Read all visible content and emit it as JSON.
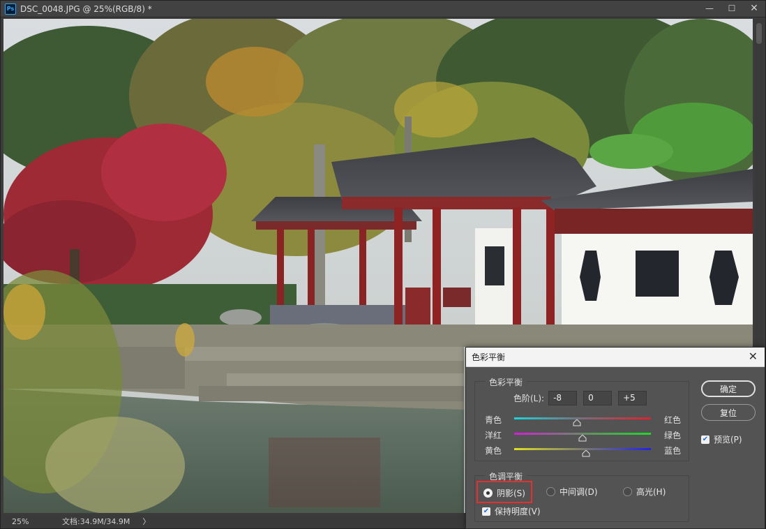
{
  "document": {
    "title": "DSC_0048.JPG @ 25%(RGB/8) *",
    "app_icon": "Ps",
    "zoom": "25%",
    "doc_info": "文档:34.9M/34.9M",
    "status_arrow": "〉",
    "controls": {
      "minimize": "—",
      "maximize": "☐",
      "close": "✕"
    }
  },
  "dialog": {
    "title": "色彩平衡",
    "close": "✕",
    "color_balance": {
      "group_label": "色彩平衡",
      "levels_label": "色阶(L):",
      "levels": [
        "-8",
        "0",
        "+5"
      ],
      "sliders": [
        {
          "left": "青色",
          "right": "红色",
          "value": -8
        },
        {
          "left": "洋红",
          "right": "绿色",
          "value": 0
        },
        {
          "left": "黄色",
          "right": "蓝色",
          "value": 5
        }
      ]
    },
    "tone_balance": {
      "group_label": "色调平衡",
      "shadows": "阴影(S)",
      "midtones": "中间调(D)",
      "highlights": "高光(H)",
      "selected": "shadows",
      "preserve_luminosity": "保持明度(V)",
      "preserve_checked": true
    },
    "buttons": {
      "ok": "确定",
      "reset": "复位"
    },
    "preview": {
      "label": "预览(P)",
      "checked": true
    }
  }
}
